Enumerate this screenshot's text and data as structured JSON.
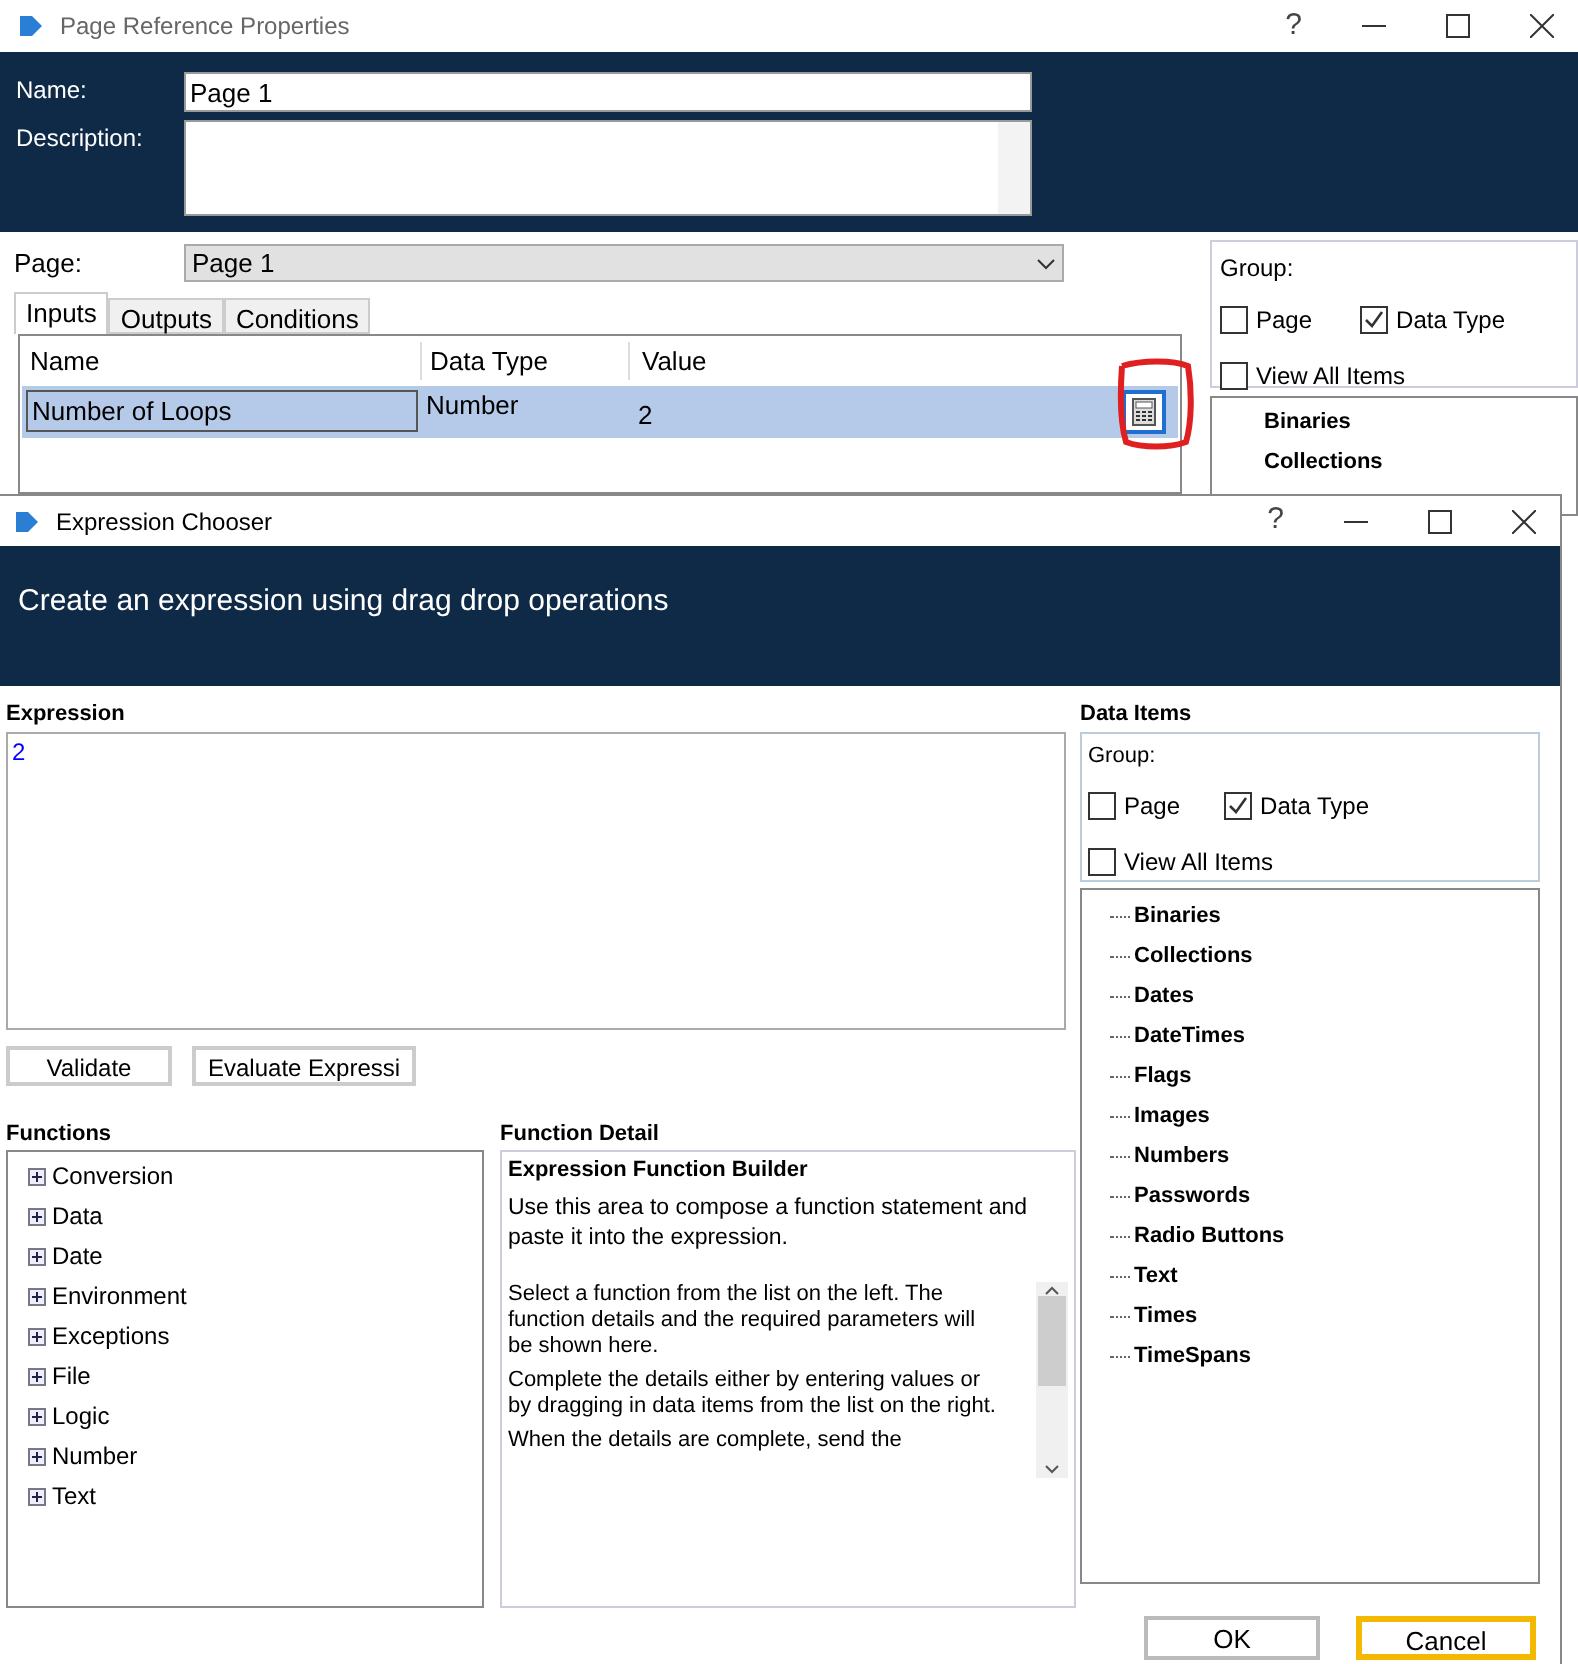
{
  "back_window": {
    "title": "Page Reference Properties",
    "help": "?",
    "name_label": "Name:",
    "name_value": "Page 1",
    "description_label": "Description:",
    "page_label": "Page:",
    "page_value": "Page 1",
    "tabs": [
      {
        "label": "Inputs",
        "selected": true
      },
      {
        "label": "Outputs",
        "selected": false
      },
      {
        "label": "Conditions",
        "selected": false
      }
    ],
    "table": {
      "columns": [
        "Name",
        "Data Type",
        "Value"
      ],
      "rows": [
        {
          "cells": [
            "Number of Loops",
            "Number",
            "2"
          ],
          "selected": true
        }
      ]
    },
    "group_panel": {
      "label": "Group:",
      "options": [
        {
          "label": "Page",
          "checked": false
        },
        {
          "label": "Data Type",
          "checked": true
        },
        {
          "label": "View All Items",
          "checked": false
        }
      ],
      "tree": [
        "Binaries",
        "Collections"
      ]
    }
  },
  "dialog": {
    "title": "Expression Chooser",
    "help": "?",
    "heading": "Create an expression using drag drop operations",
    "expression_label": "Expression",
    "expression_value": "2",
    "buttons": [
      {
        "label": "Validate"
      },
      {
        "label": "Evaluate Expressi"
      }
    ],
    "functions_label": "Functions",
    "functions": [
      "Conversion",
      "Data",
      "Date",
      "Environment",
      "Exceptions",
      "File",
      "Logic",
      "Number",
      "Text"
    ],
    "detail_label": "Function Detail",
    "detail_title": "Expression Function Builder",
    "detail_intro": "Use this area to compose a function statement and paste it into the expression.",
    "detail_paragraphs": [
      "Select a function from the list on the left. The function details and the required parameters will be shown here.",
      "Complete the details either by entering values or by dragging in data items from the list on the right.",
      "When the details are complete, send the"
    ],
    "data_items_label": "Data Items",
    "group_label": "Group:",
    "group_options": [
      {
        "label": "Page",
        "checked": false
      },
      {
        "label": "Data Type",
        "checked": true
      },
      {
        "label": "View All Items",
        "checked": false
      }
    ],
    "data_items": [
      "Binaries",
      "Collections",
      "Dates",
      "DateTimes",
      "Flags",
      "Images",
      "Numbers",
      "Passwords",
      "Radio Buttons",
      "Text",
      "Times",
      "TimeSpans"
    ],
    "footer_buttons": [
      {
        "label": "OK",
        "focused": false
      },
      {
        "label": "Cancel",
        "focused": true
      }
    ]
  }
}
